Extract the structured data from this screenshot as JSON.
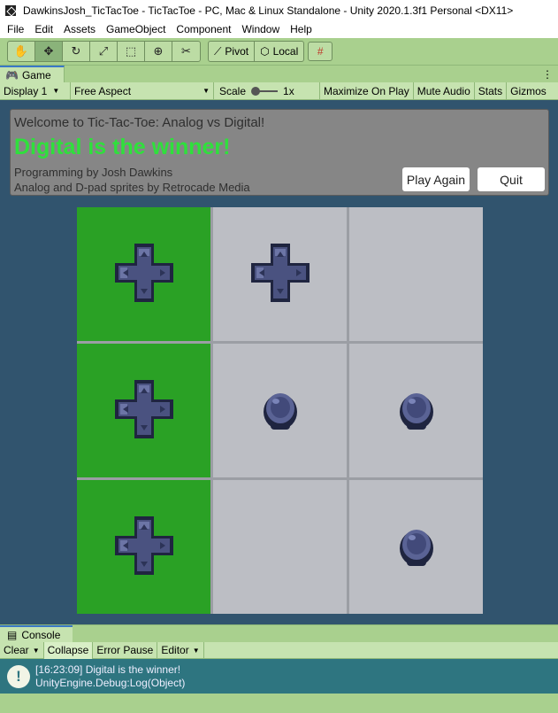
{
  "window": {
    "title": "DawkinsJosh_TicTacToe - TicTacToe - PC, Mac & Linux Standalone - Unity 2020.1.3f1 Personal <DX11>"
  },
  "menu": [
    "File",
    "Edit",
    "Assets",
    "GameObject",
    "Component",
    "Window",
    "Help"
  ],
  "toolbar": {
    "tools": [
      "hand-tool-icon",
      "move-tool-icon",
      "rotate-tool-icon",
      "scale-tool-icon",
      "rect-tool-icon",
      "transform-tool-icon",
      "custom-tool-icon"
    ],
    "pivot_label": "Pivot",
    "local_label": "Local"
  },
  "game_tab": {
    "label": "Game"
  },
  "game_toolbar": {
    "display": "Display 1",
    "aspect": "Free Aspect",
    "scale_label": "Scale",
    "scale_value": "1x",
    "maximize": "Maximize On Play",
    "mute": "Mute Audio",
    "stats": "Stats",
    "gizmos": "Gizmos"
  },
  "banner": {
    "welcome": "Welcome to Tic-Tac-Toe: Analog vs Digital!",
    "winner": "Digital is the winner!",
    "credit1": "Programming by Josh Dawkins",
    "credit2": "Analog and D-pad sprites by Retrocade Media",
    "play_again": "Play Again",
    "quit": "Quit"
  },
  "board": {
    "cells": [
      {
        "piece": "dpad",
        "highlight": true
      },
      {
        "piece": "dpad",
        "highlight": false
      },
      {
        "piece": "",
        "highlight": false
      },
      {
        "piece": "dpad",
        "highlight": true
      },
      {
        "piece": "analog",
        "highlight": false
      },
      {
        "piece": "analog",
        "highlight": false
      },
      {
        "piece": "dpad",
        "highlight": true
      },
      {
        "piece": "",
        "highlight": false
      },
      {
        "piece": "analog",
        "highlight": false
      }
    ]
  },
  "console_tab": {
    "label": "Console"
  },
  "console_toolbar": {
    "clear": "Clear",
    "collapse": "Collapse",
    "error_pause": "Error Pause",
    "editor": "Editor"
  },
  "console_log": {
    "line1": "[16:23:09] Digital is the winner!",
    "line2": "UnityEngine.Debug:Log(Object)"
  },
  "colors": {
    "win_cell": "#2aa125",
    "empty_cell": "#bcbec4",
    "winner_text": "#2fe03c",
    "game_bg": "#31546e"
  }
}
